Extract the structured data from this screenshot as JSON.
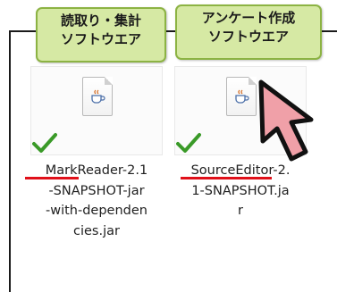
{
  "callouts": {
    "left": {
      "line1": "読取り・集計",
      "line2": "ソフトウエア"
    },
    "right": {
      "line1": "アンケート作成",
      "line2": "ソフトウエア"
    }
  },
  "files": [
    {
      "name_underlined": "MarkReader",
      "name_rest": "-2.1",
      "line2": "-SNAPSHOT-jar",
      "line3": "-with-dependen",
      "line4": "cies.jar"
    },
    {
      "name_underlined": "SourceEditor",
      "name_rest": "-2.",
      "line2": "1-SNAPSHOT.ja",
      "line3": "r",
      "line4": ""
    }
  ],
  "icons": {
    "file": "java-jar-file-icon",
    "check": "green-checkmark-icon",
    "pointer": "arrow-pointer-icon"
  },
  "colors": {
    "callout_fill": "#d6e9a4",
    "callout_border": "#8cb343",
    "underline_red": "#e0101a",
    "pointer_fill": "#f0a0a8",
    "check_green": "#3a9a28"
  }
}
